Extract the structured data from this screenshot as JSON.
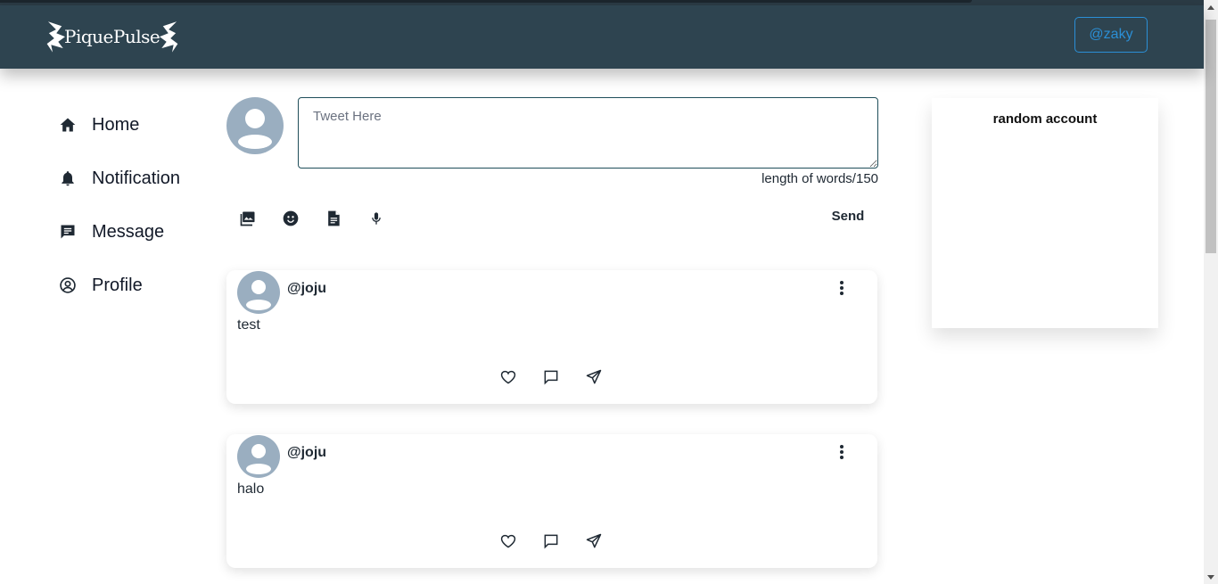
{
  "header": {
    "logo_text": "PiquePulse",
    "user_button": "@zaky"
  },
  "sidebar": {
    "items": [
      {
        "label": "Home",
        "icon": "home-icon"
      },
      {
        "label": "Notification",
        "icon": "bell-icon"
      },
      {
        "label": "Message",
        "icon": "message-icon"
      },
      {
        "label": "Profile",
        "icon": "user-circle-icon"
      }
    ]
  },
  "composer": {
    "placeholder": "Tweet Here",
    "value": "",
    "counter": "length of words/150",
    "tools": [
      "image-icon",
      "emoji-icon",
      "document-icon",
      "microphone-icon"
    ],
    "send_label": "Send"
  },
  "posts": [
    {
      "handle": "@joju",
      "text": "test"
    },
    {
      "handle": "@joju",
      "text": "halo"
    }
  ],
  "right_panel": {
    "title": "random account"
  },
  "colors": {
    "header_bg": "#2e4450",
    "accent": "#2b8fd6",
    "avatar": "#9aaec0"
  }
}
